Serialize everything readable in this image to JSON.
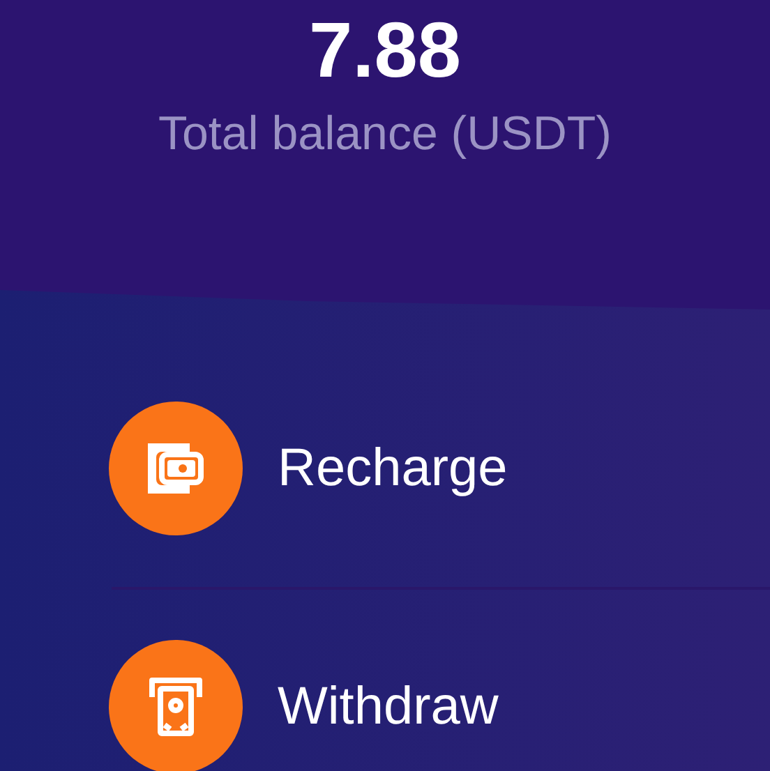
{
  "balance": {
    "amount": "7.88",
    "label": "Total balance (USDT)"
  },
  "actions": [
    {
      "kind": "wallet",
      "label": "Recharge"
    },
    {
      "kind": "atm",
      "label": "Withdraw"
    }
  ]
}
